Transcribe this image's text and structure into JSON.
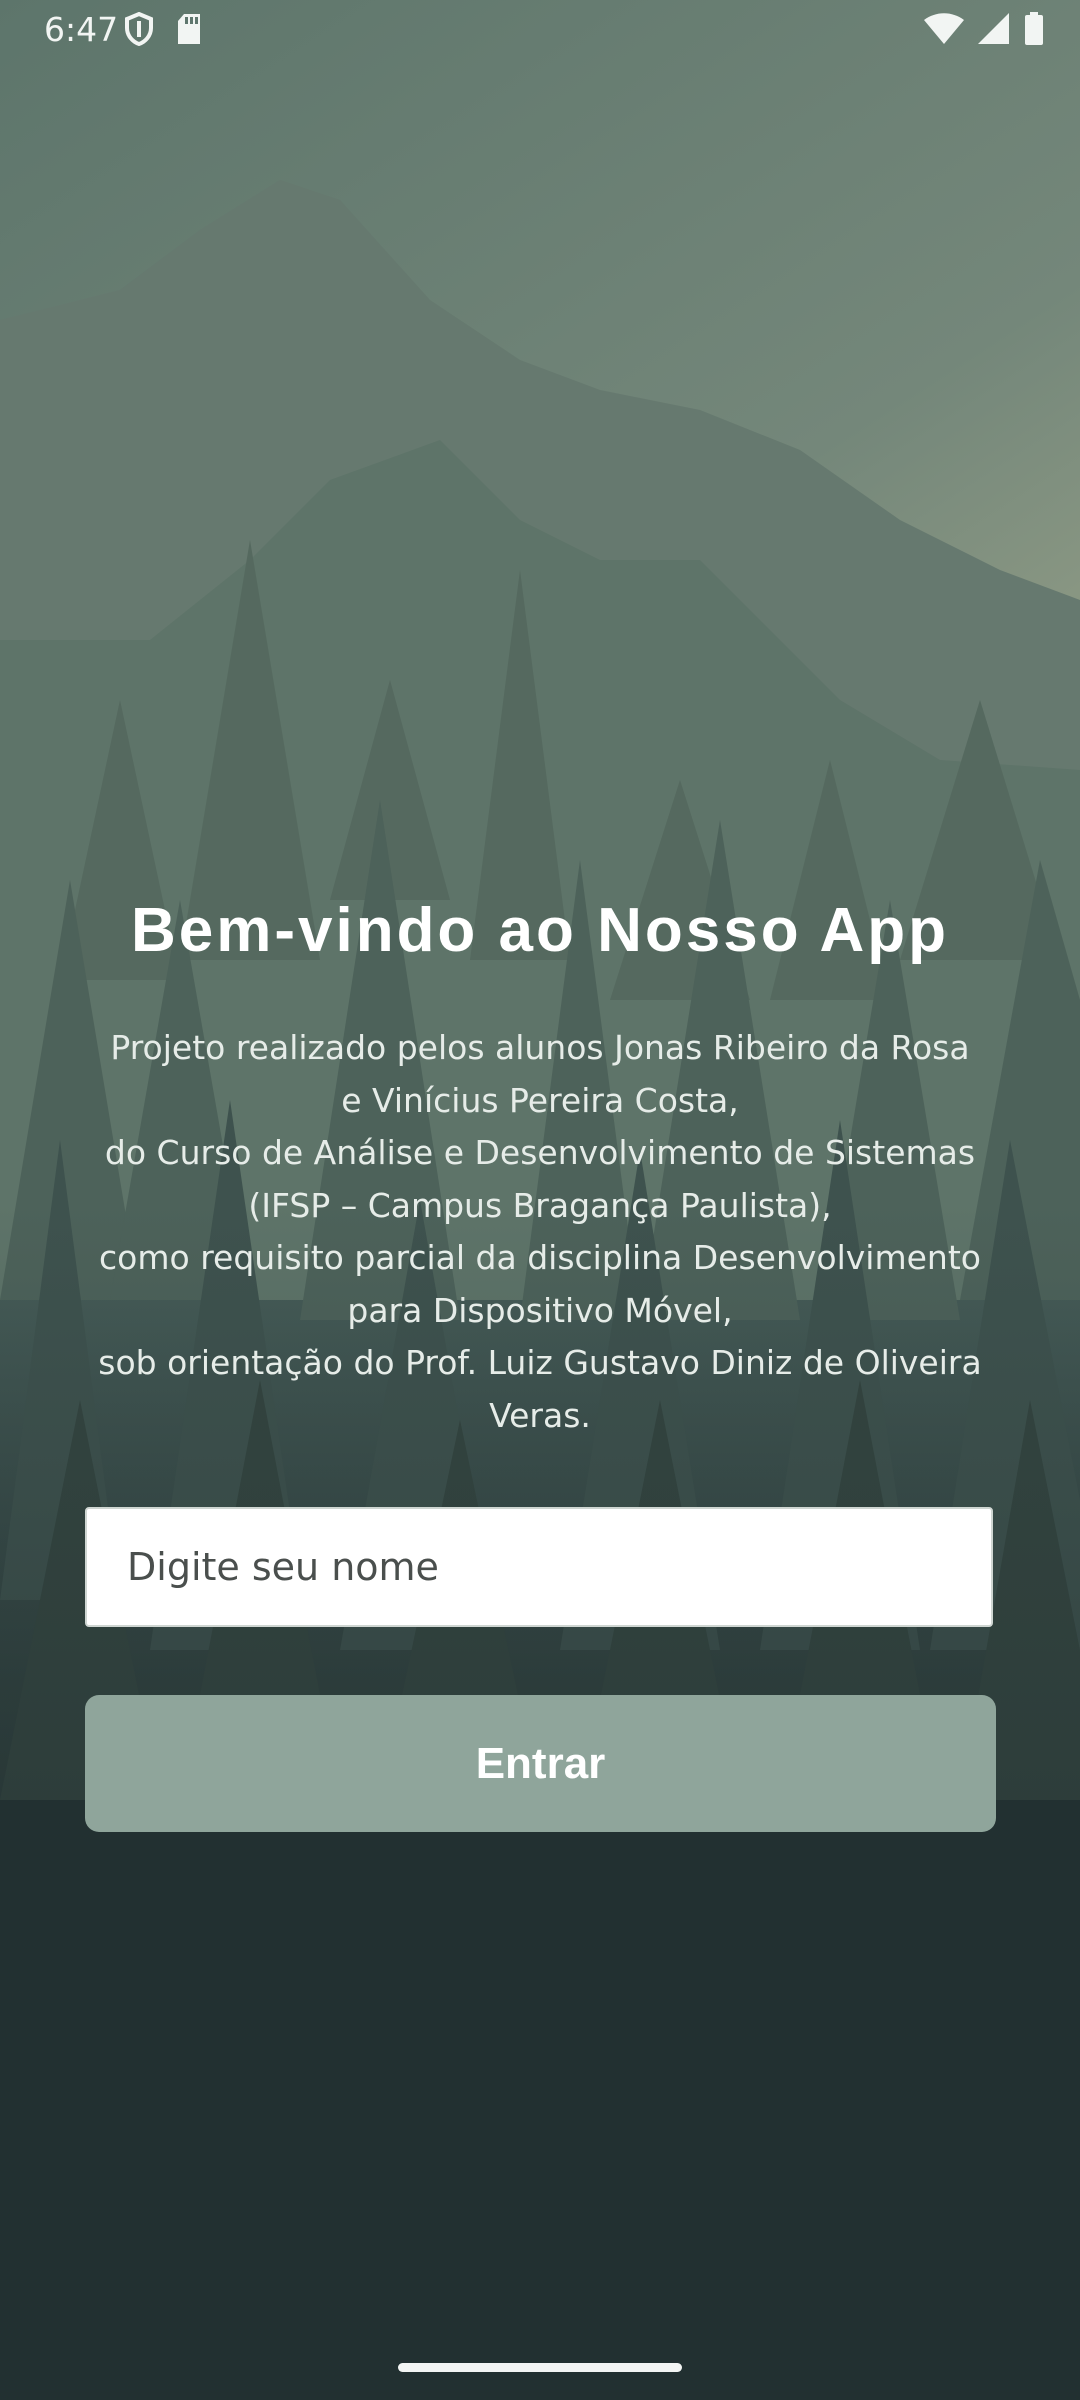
{
  "status_bar": {
    "time": "6:47",
    "left_icons": [
      "shield-icon",
      "sd-card-icon"
    ],
    "right_icons": [
      "wifi-icon",
      "cell-signal-icon",
      "battery-icon"
    ]
  },
  "welcome": {
    "title": "Bem-vindo ao Nosso App",
    "description": "Projeto realizado pelos alunos Jonas Ribeiro da Rosa\ne Vinícius Pereira Costa,\ndo Curso de Análise e Desenvolvimento de Sistemas\n(IFSP – Campus Bragança Paulista),\ncomo requisito parcial da disciplina Desenvolvimento\npara Dispositivo Móvel,\nsob orientação do Prof. Luiz Gustavo Diniz de Oliveira\nVeras."
  },
  "form": {
    "name_placeholder": "Digite seu nome",
    "name_value": "",
    "enter_label": "Entrar"
  },
  "colors": {
    "button": "#8fa59b",
    "background_top": "#5f776e",
    "background_bottom": "#223031"
  }
}
